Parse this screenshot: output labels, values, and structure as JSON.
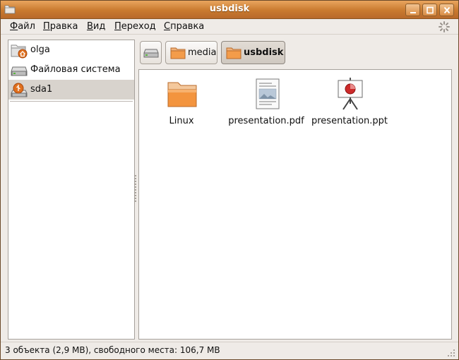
{
  "window": {
    "title": "usbdisk",
    "accent": "#d5883e"
  },
  "menubar": {
    "items": [
      {
        "first": "Ф",
        "rest": "айл"
      },
      {
        "first": "П",
        "rest": "равка"
      },
      {
        "first": "В",
        "rest": "ид"
      },
      {
        "first": "П",
        "rest": "ереход"
      },
      {
        "first": "С",
        "rest": "правка"
      }
    ]
  },
  "sidebar": {
    "items": [
      {
        "label": "olga",
        "icon": "home-folder-icon"
      },
      {
        "label": "Файловая система",
        "icon": "hard-drive-icon"
      },
      {
        "label": "sda1",
        "icon": "usb-drive-icon",
        "selected": true
      }
    ]
  },
  "pathbar": {
    "buttons": [
      {
        "label": "",
        "icon": "hard-drive-icon"
      },
      {
        "label": "media",
        "icon": "folder-icon"
      },
      {
        "label": "usbdisk",
        "icon": "folder-icon",
        "active": true
      }
    ]
  },
  "files": [
    {
      "name": "Linux",
      "icon": "folder-icon"
    },
    {
      "name": "presentation.pdf",
      "icon": "pdf-document-icon"
    },
    {
      "name": "presentation.ppt",
      "icon": "presentation-icon"
    }
  ],
  "statusbar": {
    "text": "3 объекта (2,9 MB), свободного места: 106,7 MB"
  }
}
